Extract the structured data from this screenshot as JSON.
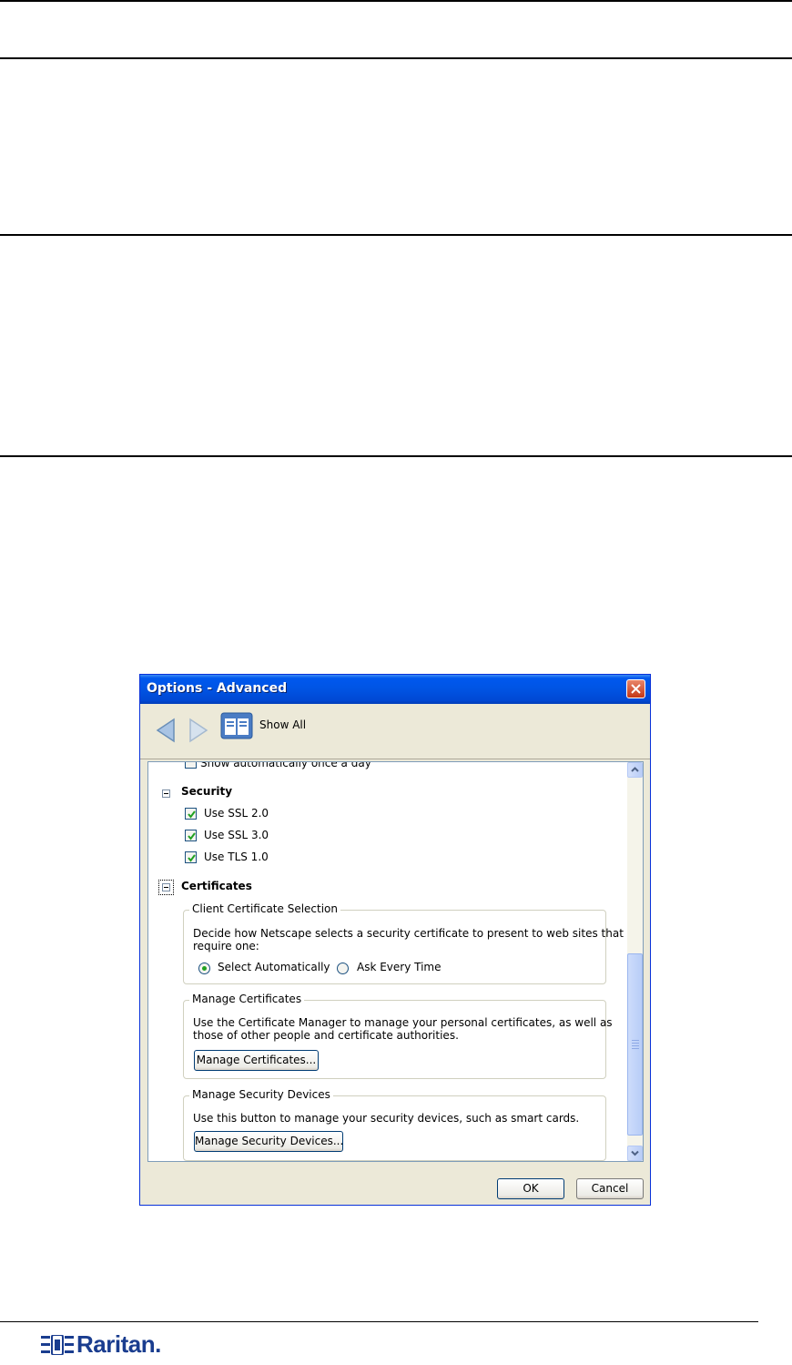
{
  "dialog": {
    "title": "Options - Advanced",
    "toolbar": {
      "show_all_label": "Show All"
    },
    "truncated_item": "Show automatically once a day",
    "security": {
      "heading": "Security",
      "items": [
        {
          "label": "Use SSL 2.0",
          "checked": true
        },
        {
          "label": "Use SSL 3.0",
          "checked": true
        },
        {
          "label": "Use TLS 1.0",
          "checked": true
        }
      ]
    },
    "certificates": {
      "heading": "Certificates",
      "client_selection": {
        "legend": "Client Certificate Selection",
        "desc_line1": "Decide how Netscape selects a security certificate to present to web sites that",
        "desc_line2": "require one:",
        "option_auto": "Select Automatically",
        "option_ask": "Ask Every Time",
        "selected": "Select Automatically"
      },
      "manage_certificates": {
        "legend": "Manage Certificates",
        "desc_line1": "Use the Certificate Manager to manage your personal certificates, as well as",
        "desc_line2": "those of other people and certificate authorities.",
        "button": "Manage Certificates..."
      },
      "manage_devices": {
        "legend": "Manage Security Devices",
        "desc": "Use this button to manage your security devices, such as smart cards.",
        "button": "Manage Security Devices..."
      }
    },
    "ok_label": "OK",
    "cancel_label": "Cancel"
  },
  "footer": {
    "logo_text": "Raritan."
  },
  "colors": {
    "titlebar": "#0054e3",
    "dialog_bg": "#ece9d8",
    "logo": "#1a3d8f"
  }
}
